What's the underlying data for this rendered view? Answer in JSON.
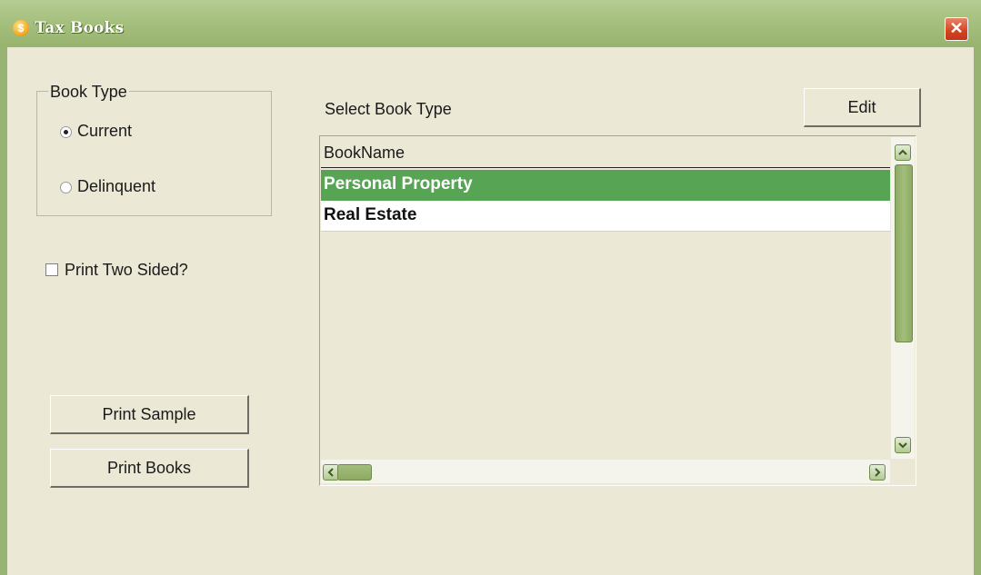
{
  "window": {
    "title": "Tax Books",
    "close_glyph": "✕",
    "icon_glyph": "$",
    "title_icon": "coin-icon"
  },
  "book_type": {
    "legend": "Book Type",
    "options": [
      {
        "label": "Current",
        "checked": true
      },
      {
        "label": "Delinquent",
        "checked": false
      }
    ]
  },
  "print_two_sided": {
    "label": "Print Two Sided?",
    "checked": false
  },
  "buttons": {
    "print_sample": "Print Sample",
    "print_books": "Print Books",
    "edit": "Edit"
  },
  "list": {
    "caption": "Select Book Type",
    "column_header": "BookName",
    "rows": [
      {
        "name": "Personal Property",
        "selected": true
      },
      {
        "name": "Real Estate",
        "selected": false
      }
    ]
  },
  "colors": {
    "titlebar": "#a6c07f",
    "selection": "#57a454",
    "close_button": "#d4441f",
    "window_bg": "#ebe8d6"
  }
}
